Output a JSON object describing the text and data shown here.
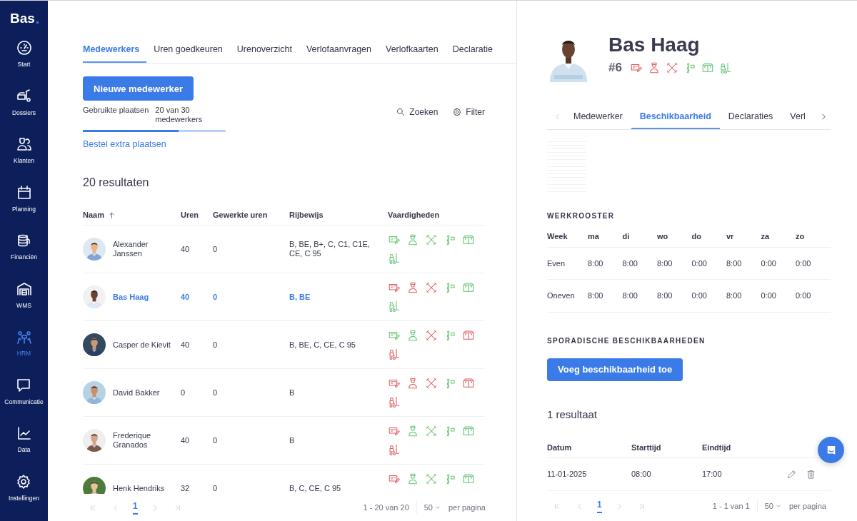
{
  "sidebar": {
    "logo": "Bas",
    "items": [
      {
        "label": "Start",
        "selected": false
      },
      {
        "label": "Dossiers",
        "selected": false
      },
      {
        "label": "Klanten",
        "selected": false
      },
      {
        "label": "Planning",
        "selected": false
      },
      {
        "label": "Financiën",
        "selected": false
      },
      {
        "label": "WMS",
        "selected": false
      },
      {
        "label": "HRM",
        "selected": true
      },
      {
        "label": "Communicatie",
        "selected": false
      },
      {
        "label": "Data",
        "selected": false
      },
      {
        "label": "Instellingen",
        "selected": false
      }
    ]
  },
  "tabs": [
    {
      "label": "Medewerkers",
      "selected": true
    },
    {
      "label": "Uren goedkeuren",
      "selected": false
    },
    {
      "label": "Urenoverzicht",
      "selected": false
    },
    {
      "label": "Verlofaanvragen",
      "selected": false
    },
    {
      "label": "Verlofkaarten",
      "selected": false
    },
    {
      "label": "Declaratie",
      "selected": false
    }
  ],
  "new_button": "Nieuwe medewerker",
  "seats": {
    "label": "Gebruikte plaatsen",
    "value": "20 van 30 medewerkers",
    "level": 0.67,
    "link": "Bestel extra plaatsen"
  },
  "search": "Zoeken",
  "filter": "Filter",
  "result_count": "20 resultaten",
  "table": {
    "columns": [
      {
        "label": "Naam",
        "sorted": true
      },
      {
        "label": "Uren",
        "sorted": false
      },
      {
        "label": "Gewerkte uren",
        "sorted": false
      },
      {
        "label": "Rijbewijs",
        "sorted": false
      },
      {
        "label": "Vaardigheden",
        "sorted": false
      }
    ],
    "rows": [
      {
        "name": "Alexander Janssen",
        "hours": "40",
        "worked": "0",
        "license": "B, BE, B+, C, C1, C1E, CE, C 95",
        "selected": false,
        "skills": [
          {
            "ok": true
          },
          {
            "ok": true
          },
          {
            "ok": true
          },
          {
            "ok": true
          },
          {
            "ok": true
          },
          {
            "ok": true
          }
        ]
      },
      {
        "name": "Bas Haag",
        "hours": "40",
        "worked": "0",
        "license": "B, BE",
        "selected": true,
        "skills": [
          {
            "ok": false
          },
          {
            "ok": false
          },
          {
            "ok": false
          },
          {
            "ok": true
          },
          {
            "ok": true
          },
          {
            "ok": true
          }
        ]
      },
      {
        "name": "Casper de Kievit",
        "hours": "40",
        "worked": "0",
        "license": "B, BE, C, CE, C 95",
        "selected": false,
        "skills": [
          {
            "ok": true
          },
          {
            "ok": true
          },
          {
            "ok": false
          },
          {
            "ok": true
          },
          {
            "ok": false
          },
          {
            "ok": false
          }
        ]
      },
      {
        "name": "David Bakker",
        "hours": "0",
        "worked": "0",
        "license": "B",
        "selected": false,
        "skills": [
          {
            "ok": false
          },
          {
            "ok": false
          },
          {
            "ok": false
          },
          {
            "ok": true
          },
          {
            "ok": false
          },
          {
            "ok": false
          }
        ]
      },
      {
        "name": "Frederique Granados",
        "hours": "40",
        "worked": "0",
        "license": "B",
        "selected": false,
        "skills": [
          {
            "ok": false
          },
          {
            "ok": true
          },
          {
            "ok": true
          },
          {
            "ok": true
          },
          {
            "ok": true
          },
          {
            "ok": false
          }
        ]
      },
      {
        "name": "Henk Hendriks",
        "hours": "32",
        "worked": "0",
        "license": "B, C, CE, C 95",
        "selected": false,
        "skills": [
          {
            "ok": false
          },
          {
            "ok": true
          },
          {
            "ok": true
          },
          {
            "ok": true
          },
          {
            "ok": true
          }
        ]
      }
    ]
  },
  "pagination": {
    "pages": [
      {
        "label": "1",
        "selected": true
      }
    ],
    "range": "1 - 20 van 20",
    "per_page": "50",
    "per_page_label": "per pagina"
  },
  "detail": {
    "name": "Bas Haag",
    "number": "#6",
    "skills": [
      {
        "ok": false
      },
      {
        "ok": false
      },
      {
        "ok": false
      },
      {
        "ok": true
      },
      {
        "ok": true
      },
      {
        "ok": true
      }
    ],
    "tabs": [
      {
        "label": "Medewerker",
        "selected": false
      },
      {
        "label": "Beschikbaarheid",
        "selected": true
      },
      {
        "label": "Declaraties",
        "selected": false
      },
      {
        "label": "Verl",
        "selected": false
      }
    ],
    "schedule": {
      "title": "WERKROOSTER",
      "columns": [
        "Week",
        "ma",
        "di",
        "wo",
        "do",
        "vr",
        "za",
        "zo"
      ],
      "rows": [
        {
          "week": "Even",
          "days": [
            "8:00",
            "8:00",
            "8:00",
            "0:00",
            "8:00",
            "0:00",
            "0:00"
          ]
        },
        {
          "week": "Oneven",
          "days": [
            "8:00",
            "8:00",
            "8:00",
            "0:00",
            "8:00",
            "0:00",
            "0:00"
          ]
        }
      ]
    },
    "sporadic": {
      "title": "SPORADISCHE BESCHIKBAARHEDEN",
      "button": "Voeg beschikbaarheid toe",
      "result_count": "1 resultaat",
      "columns": [
        "Datum",
        "Starttijd",
        "Eindtijd"
      ],
      "rows": [
        {
          "date": "11-01-2025",
          "start": "08:00",
          "end": "17:00"
        }
      ]
    },
    "pagination": {
      "pages": [
        {
          "label": "1",
          "selected": true
        }
      ],
      "range": "1 - 1 van 1",
      "per_page": "50",
      "per_page_label": "per pagina"
    }
  }
}
